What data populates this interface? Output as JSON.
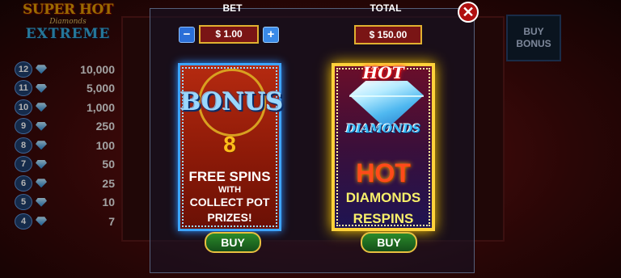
{
  "logo": {
    "line1": "SUPER HOT",
    "line2": "Diamonds",
    "line3": "EXTREME"
  },
  "paytable": [
    {
      "level": "12",
      "prize": "10,000"
    },
    {
      "level": "11",
      "prize": "5,000"
    },
    {
      "level": "10",
      "prize": "1,000"
    },
    {
      "level": "9",
      "prize": "250"
    },
    {
      "level": "8",
      "prize": "100"
    },
    {
      "level": "7",
      "prize": "50"
    },
    {
      "level": "6",
      "prize": "25"
    },
    {
      "level": "5",
      "prize": "10"
    },
    {
      "level": "4",
      "prize": "7"
    }
  ],
  "background_buy_bonus": "BUY BONUS",
  "bet": {
    "label": "BET",
    "value": "$ 1.00",
    "minus_icon": "minus-icon",
    "plus_icon": "plus-icon"
  },
  "total": {
    "label": "TOTAL",
    "value": "$ 150.00"
  },
  "close_icon": "close-icon",
  "offers": {
    "bonus": {
      "title": "BONUS",
      "spins": "8",
      "line1": "FREE SPINS",
      "line2": "WITH",
      "line3": "COLLECT POT PRIZES!",
      "buy_label": "BUY",
      "border_color": "#3da5ff"
    },
    "hot_diamonds": {
      "logo_hot": "HOT",
      "logo_diamonds": "DIAMONDS",
      "title": "HOT",
      "line1": "DIAMONDS",
      "line2": "RESPINS",
      "buy_label": "BUY",
      "border_color": "#ffd23a"
    }
  },
  "colors": {
    "value_box": "#7a1515",
    "buy_button": "#2c8a2a",
    "close_button": "#b01010"
  }
}
